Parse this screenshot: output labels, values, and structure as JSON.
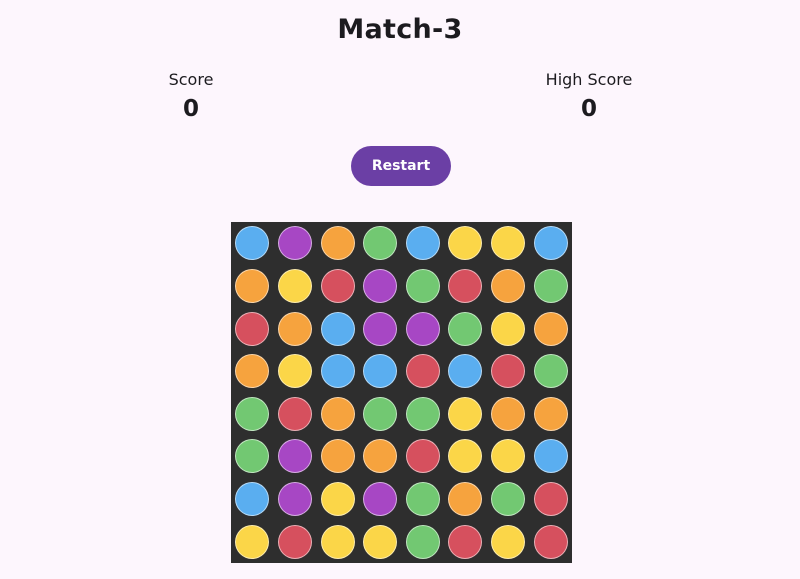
{
  "title": "Match-3",
  "score": {
    "label": "Score",
    "value": "0"
  },
  "high_score": {
    "label": "High Score",
    "value": "0"
  },
  "restart_label": "Restart",
  "colors": {
    "blue": "#5aaef0",
    "purple": "#a747c4",
    "orange": "#f6a33e",
    "green": "#72c872",
    "yellow": "#fbd648",
    "red": "#d6505e",
    "board_bg": "#2e2e2e",
    "button_bg": "#6b3fa5",
    "page_bg": "#fdf6fd"
  },
  "board": [
    [
      "blue",
      "purple",
      "orange",
      "green",
      "blue",
      "yellow",
      "yellow",
      "blue"
    ],
    [
      "orange",
      "yellow",
      "red",
      "purple",
      "green",
      "red",
      "orange",
      "green"
    ],
    [
      "red",
      "orange",
      "blue",
      "purple",
      "purple",
      "green",
      "yellow",
      "orange"
    ],
    [
      "orange",
      "yellow",
      "blue",
      "blue",
      "red",
      "blue",
      "red",
      "green"
    ],
    [
      "green",
      "red",
      "orange",
      "green",
      "green",
      "yellow",
      "orange",
      "orange"
    ],
    [
      "green",
      "purple",
      "orange",
      "orange",
      "red",
      "yellow",
      "yellow",
      "blue"
    ],
    [
      "blue",
      "purple",
      "yellow",
      "purple",
      "green",
      "orange",
      "green",
      "red"
    ],
    [
      "yellow",
      "red",
      "yellow",
      "yellow",
      "green",
      "red",
      "yellow",
      "red"
    ]
  ]
}
